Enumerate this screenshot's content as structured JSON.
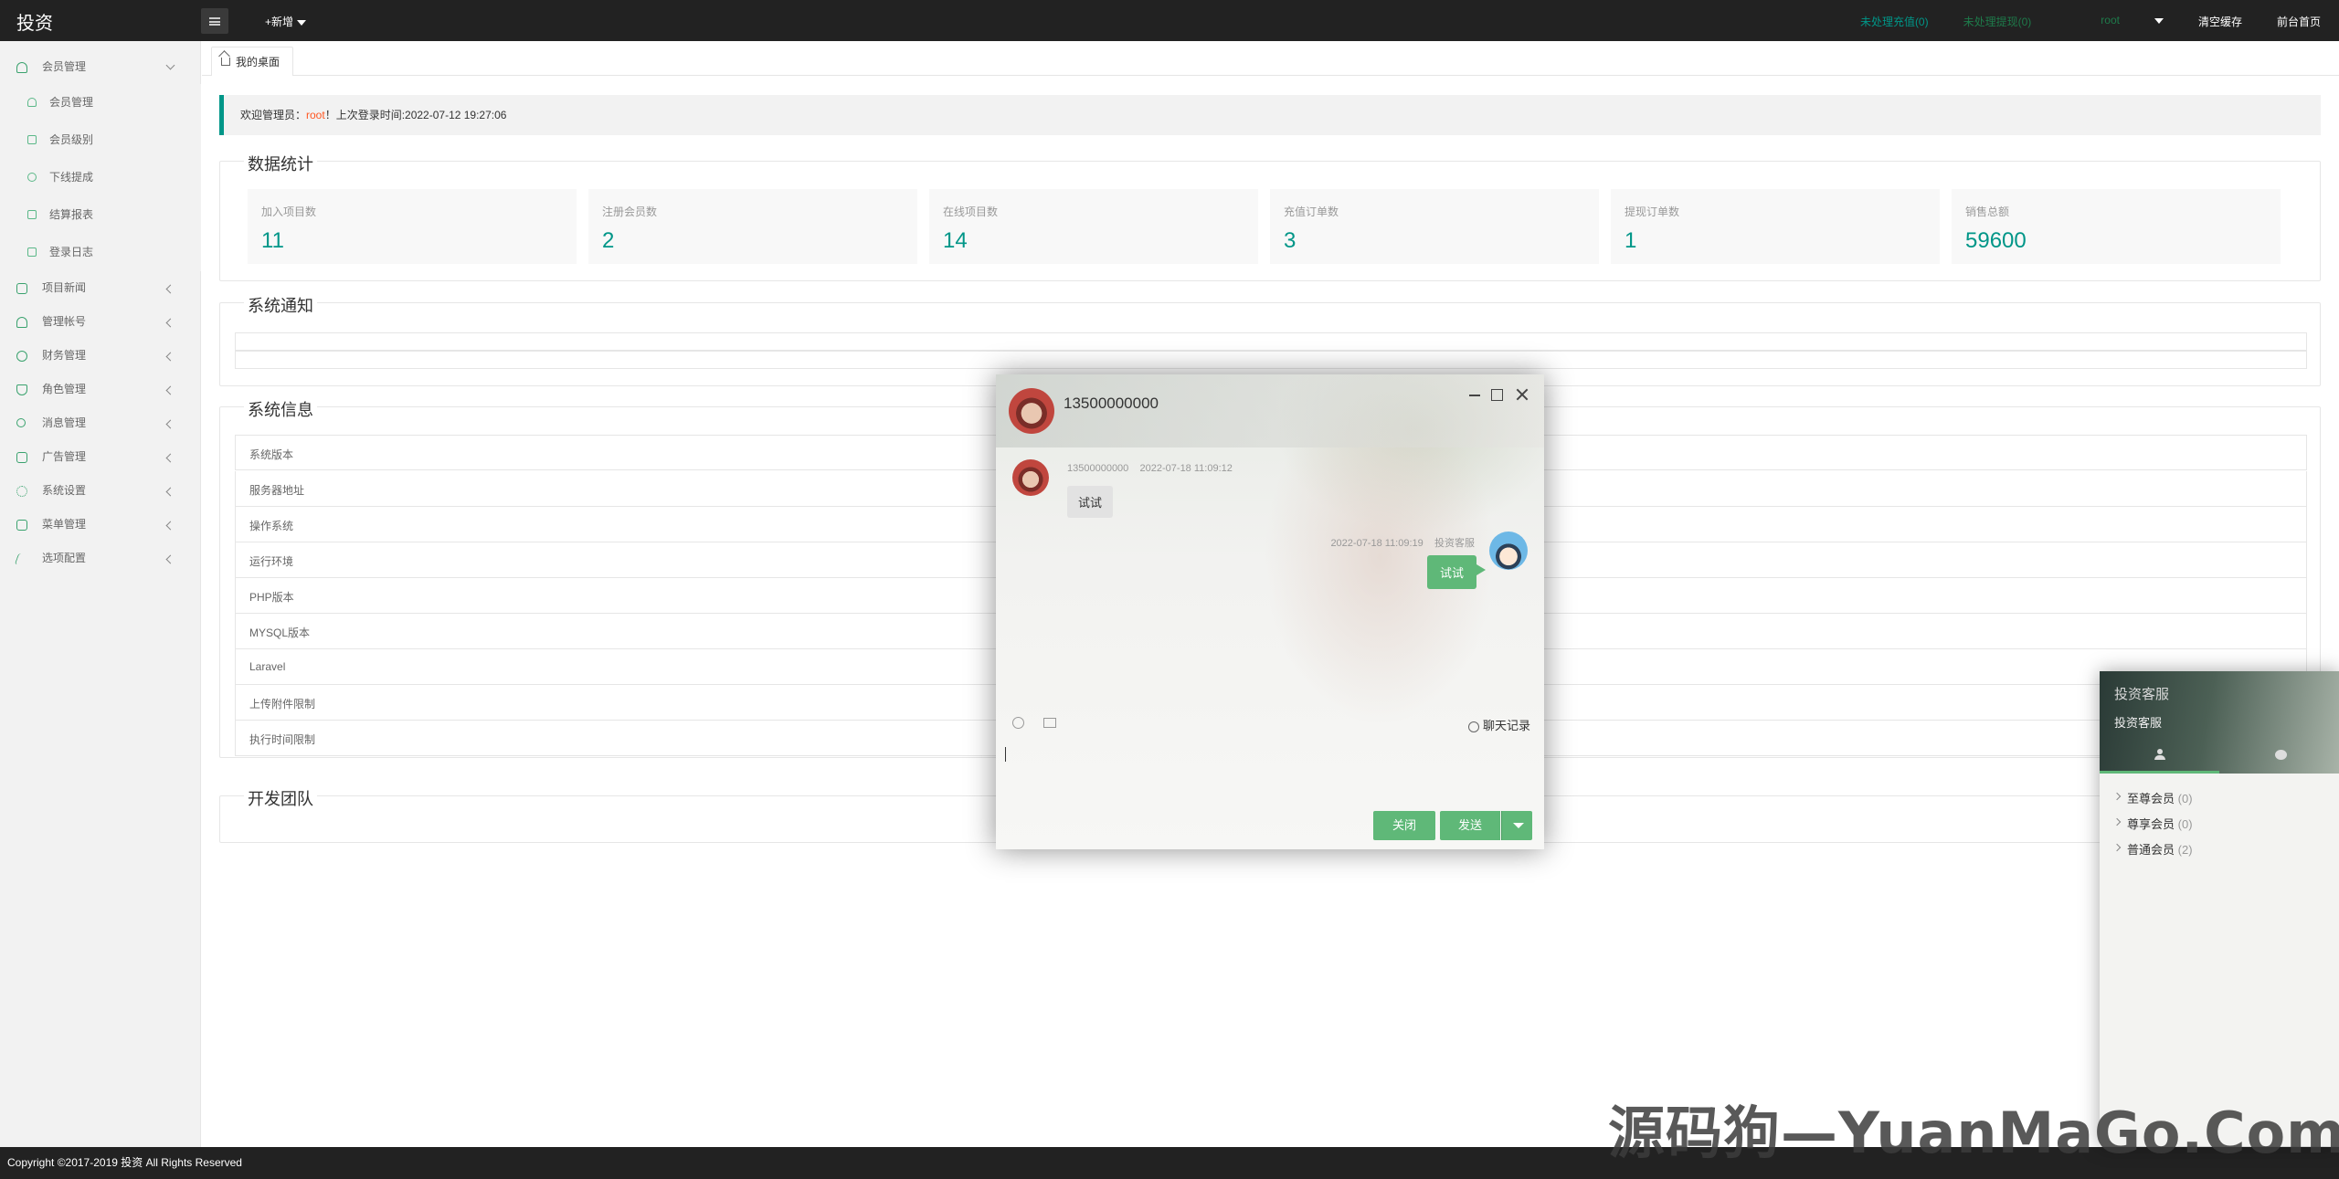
{
  "app": {
    "title": "投资"
  },
  "topbar": {
    "add_label": "+新增",
    "notice1": "未处理充值(0)",
    "notice2": "未处理提现(0)",
    "user": "root",
    "clear_cache": "清空缓存",
    "front_home": "前台首页",
    "colors": {
      "bg": "#222222",
      "accent": "#009688"
    }
  },
  "sidebar": {
    "groups": [
      {
        "label": "会员管理",
        "icon": "user-icon",
        "open": true,
        "children": [
          {
            "label": "会员管理",
            "icon": "user-icon"
          },
          {
            "label": "会员级别",
            "icon": "chart-icon"
          },
          {
            "label": "下线提成",
            "icon": "circle-icon"
          },
          {
            "label": "结算报表",
            "icon": "chart-icon"
          },
          {
            "label": "登录日志",
            "icon": "list-icon"
          }
        ]
      },
      {
        "label": "项目新闻",
        "icon": "book-icon"
      },
      {
        "label": "管理帐号",
        "icon": "users-icon"
      },
      {
        "label": "财务管理",
        "icon": "money-icon"
      },
      {
        "label": "角色管理",
        "icon": "shield-icon"
      },
      {
        "label": "消息管理",
        "icon": "message-icon"
      },
      {
        "label": "广告管理",
        "icon": "image-icon"
      },
      {
        "label": "系统设置",
        "icon": "gear-icon"
      },
      {
        "label": "菜单管理",
        "icon": "menu-icon"
      },
      {
        "label": "选项配置",
        "icon": "option-icon"
      }
    ]
  },
  "tabs": [
    {
      "label": "我的桌面",
      "icon": "home-icon"
    }
  ],
  "welcome": {
    "prefix": "欢迎管理员：",
    "user": "root",
    "suffix": "！上次登录时间:2022-07-12 19:27:06"
  },
  "stats": {
    "title": "数据统计",
    "items": [
      {
        "label": "加入项目数",
        "value": "11"
      },
      {
        "label": "注册会员数",
        "value": "2"
      },
      {
        "label": "在线项目数",
        "value": "14"
      },
      {
        "label": "充值订单数",
        "value": "3"
      },
      {
        "label": "提现订单数",
        "value": "1"
      },
      {
        "label": "销售总额",
        "value": "59600"
      }
    ]
  },
  "notice": {
    "title": "系统通知"
  },
  "sysinfo": {
    "title": "系统信息",
    "rows": [
      "系统版本",
      "服务器地址",
      "操作系统",
      "运行环境",
      "PHP版本",
      "MYSQL版本",
      "Laravel",
      "上传附件限制",
      "执行时间限制"
    ]
  },
  "team": {
    "title": "开发团队"
  },
  "chat": {
    "title": "13500000000",
    "messages": [
      {
        "sender": "13500000000",
        "time": "2022-07-18 11:09:12",
        "text": "试试",
        "side": "left"
      },
      {
        "sender": "投资客服",
        "time": "2022-07-18 11:09:19",
        "text": "试试",
        "side": "right"
      }
    ],
    "history_label": "聊天记录",
    "close_label": "关闭",
    "send_label": "发送",
    "colors": {
      "button": "#5fb878"
    }
  },
  "side_panel": {
    "title": "投资客服",
    "subtitle": "投资客服",
    "groups": [
      {
        "name": "至尊会员",
        "count": "(0)"
      },
      {
        "name": "尊享会员",
        "count": "(0)"
      },
      {
        "name": "普通会员",
        "count": "(2)"
      }
    ]
  },
  "footer": {
    "text": "Copyright ©2017-2019 投资 All Rights Reserved"
  },
  "watermark": {
    "text": "源码狗—YuanMaGo.Com"
  }
}
